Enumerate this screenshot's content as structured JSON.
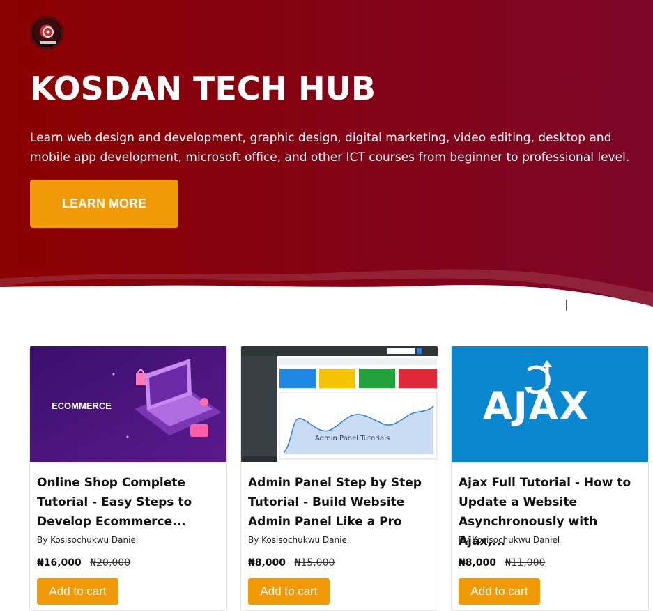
{
  "hero": {
    "title": "KOSDAN TECH HUB",
    "description": "Learn web design and development, graphic design, digital marketing, video editing, desktop and mobile app development, microsoft office, and other ICT courses from beginner to professional level.",
    "cta_label": "LEARN MORE",
    "colors": {
      "bg_start": "#8b0000",
      "bg_end": "#7a0524",
      "accent": "#f09a07"
    }
  },
  "products": [
    {
      "thumb_label": "ECOMMERCE",
      "title": "Online Shop Complete Tutorial - Easy Steps to Develop Ecommerce...",
      "author": "By Kosisochukwu Daniel",
      "price": "₦16,000",
      "old_price": "₦20,000",
      "cart_label": "Add to cart"
    },
    {
      "thumb_label": "Admin Panel Tutorials",
      "title": "Admin Panel Step by Step Tutorial - Build Website Admin Panel Like a Pro",
      "author": "By Kosisochukwu Daniel",
      "price": "₦8,000",
      "old_price": "₦15,000",
      "cart_label": "Add to cart"
    },
    {
      "thumb_label": "AJAX",
      "title": "Ajax Full Tutorial - How to Update a Website Asynchronously with Ajax,...",
      "author": "By Kosisochukwu Daniel",
      "price": "₦8,000",
      "old_price": "₦11,000",
      "cart_label": "Add to cart"
    }
  ]
}
